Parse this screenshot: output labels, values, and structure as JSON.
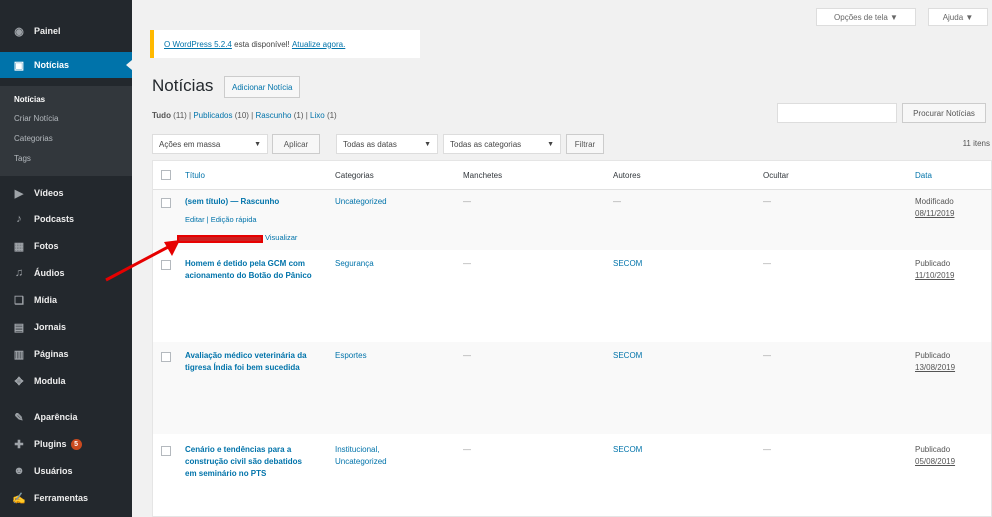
{
  "sidebar": {
    "items": [
      {
        "label": "Painel",
        "icon": "dashboard-icon",
        "glyph": "◉"
      },
      {
        "label": "Notícias",
        "icon": "posts-icon",
        "glyph": "▣",
        "active": true
      },
      {
        "label": "Vídeos",
        "icon": "video-icon",
        "glyph": "▶"
      },
      {
        "label": "Podcasts",
        "icon": "microphone-icon",
        "glyph": "♪"
      },
      {
        "label": "Fotos",
        "icon": "image-icon",
        "glyph": "▦"
      },
      {
        "label": "Áudios",
        "icon": "audio-icon",
        "glyph": "♫"
      },
      {
        "label": "Mídia",
        "icon": "media-icon",
        "glyph": "❏"
      },
      {
        "label": "Jornais",
        "icon": "newspaper-icon",
        "glyph": "▤"
      },
      {
        "label": "Páginas",
        "icon": "pages-icon",
        "glyph": "▥"
      },
      {
        "label": "Modula",
        "icon": "gallery-icon",
        "glyph": "✥"
      },
      {
        "label": "Aparência",
        "icon": "brush-icon",
        "glyph": "✎"
      },
      {
        "label": "Plugins",
        "icon": "plugin-icon",
        "glyph": "✚",
        "badge": "5"
      },
      {
        "label": "Usuários",
        "icon": "users-icon",
        "glyph": "☻"
      },
      {
        "label": "Ferramentas",
        "icon": "tools-icon",
        "glyph": "✍"
      }
    ],
    "submenu": [
      "Notícias",
      "Criar Notícia",
      "Categorias",
      "Tags"
    ]
  },
  "top": {
    "screen_options": "Opções de tela ▼",
    "help": "Ajuda ▼"
  },
  "notice": {
    "link1": "O WordPress 5.2.4",
    "text": " esta disponível! ",
    "link2": "Atualize agora."
  },
  "page": {
    "title": "Notícias",
    "add_new": "Adicionar Notícia"
  },
  "filters": {
    "all": "Tudo",
    "all_count": " (11) | ",
    "published": "Publicados",
    "published_count": " (10) | ",
    "draft": "Rascunho",
    "draft_count": " (1) | ",
    "trash": "Lixo",
    "trash_count": " (1)"
  },
  "search": {
    "button": "Procurar Notícias"
  },
  "bulk": {
    "actions": "Ações em massa",
    "apply": "Aplicar",
    "dates": "Todas as datas",
    "categories": "Todas as categorias",
    "filter": "Filtrar",
    "items_count": "11 itens"
  },
  "table": {
    "headers": {
      "title": "Título",
      "categories": "Categorias",
      "manchetes": "Manchetes",
      "authors": "Autores",
      "hide": "Ocultar",
      "date": "Data"
    },
    "rows": [
      {
        "title": "(sem título) — Rascunho",
        "actions_line1": "Editar | Edição rápida",
        "actions_line2": "Visualizar",
        "category": "Uncategorized",
        "manchetes": "—",
        "author": "—",
        "hide": "—",
        "status": "Modificado",
        "date": "08/11/2019"
      },
      {
        "title": "Homem é detido pela GCM com acionamento do Botão do Pânico",
        "category": "Segurança",
        "manchetes": "—",
        "author": "SECOM",
        "hide": "—",
        "status": "Publicado",
        "date": "11/10/2019"
      },
      {
        "title": "Avaliação médico veterinária da tigresa Índia foi bem sucedida",
        "category": "Esportes",
        "manchetes": "—",
        "author": "SECOM",
        "hide": "—",
        "status": "Publicado",
        "date": "13/08/2019"
      },
      {
        "title": "Cenário e tendências para a construção civil são debatidos em seminário no PTS",
        "category": "Institucional, Uncategorized",
        "manchetes": "—",
        "author": "SECOM",
        "hide": "—",
        "status": "Publicado",
        "date": "05/08/2019"
      }
    ]
  },
  "colors": {
    "sidebar": "#23282d",
    "active": "#0073aa",
    "highlight": "#e60000",
    "link": "#0073aa"
  }
}
